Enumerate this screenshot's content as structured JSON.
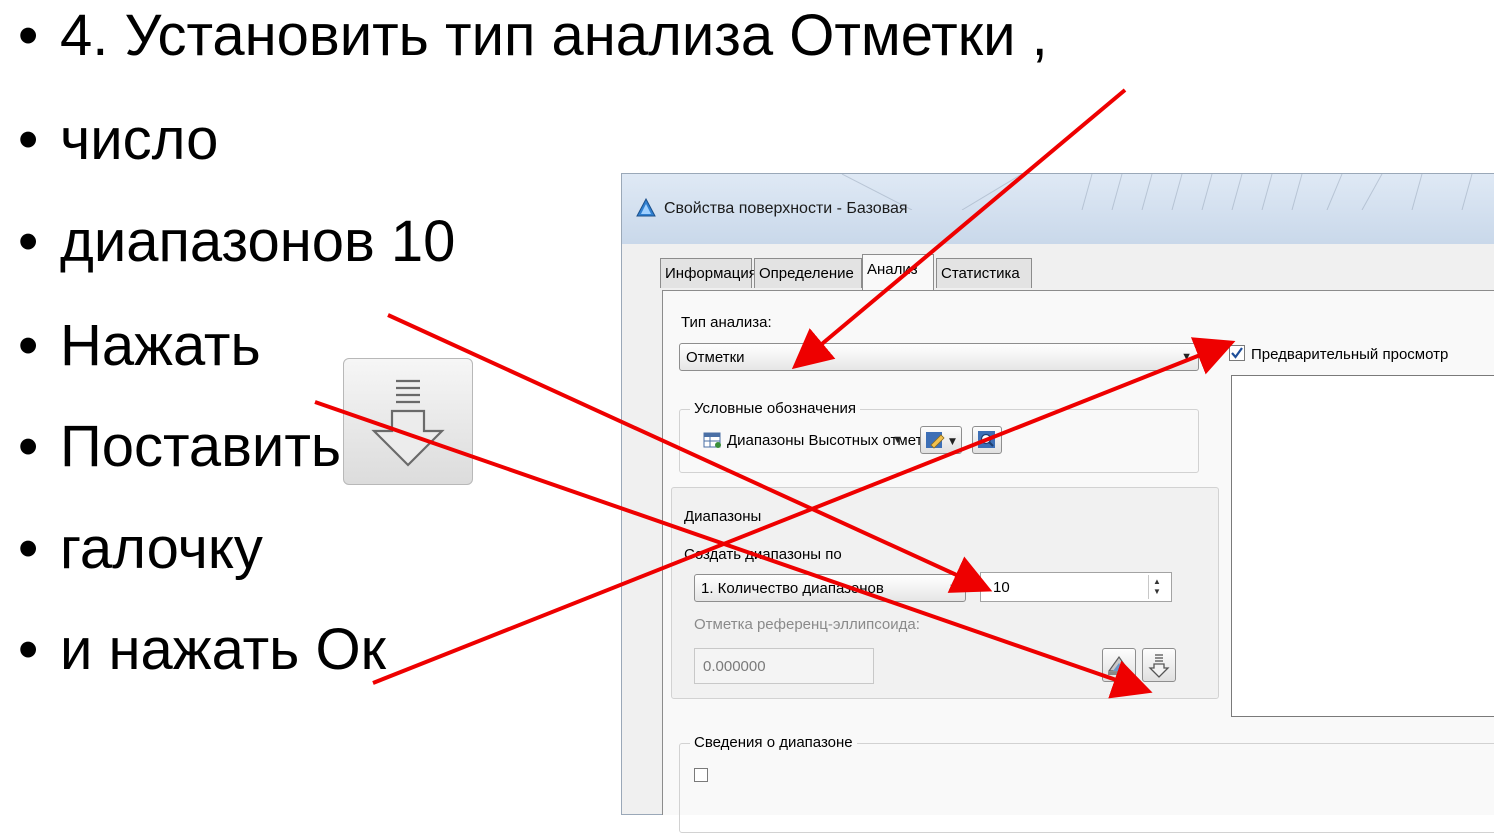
{
  "slide": {
    "bullets": [
      "4. Установить тип анализа Отметки ,",
      "число",
      "диапазонов 10",
      "Нажать",
      "Поставить",
      "галочку",
      "и нажать Ок"
    ],
    "bullet_glyph": "•",
    "big_icon": "generate-ranges-icon"
  },
  "dialog": {
    "title": "Свойства поверхности - Базовая",
    "app_icon": "autocad-civil-triangle-icon",
    "tabs": [
      "Информация",
      "Определение",
      "Анализ",
      "Статистика"
    ],
    "active_tab": "Анализ",
    "analysis_type_label": "Тип анализа:",
    "analysis_type_value": "Отметки",
    "legend_group_label": "Условные обозначения",
    "legend_value": "Диапазоны Высотных отметок",
    "ranges_group_label": "Диапазоны",
    "create_ranges_label": "Создать диапазоны по",
    "create_ranges_value": "1. Количество диапазонов",
    "ranges_count": "10",
    "reference_label": "Отметка референц-эллипсоида:",
    "reference_value": "0.000000",
    "preview_label": "Предварительный просмотр",
    "preview_checked": true,
    "range_details_label": "Сведения о диапазоне"
  },
  "colors": {
    "annotation_arrow": "#ee0000",
    "titlebar": "#d4e1f0",
    "panel": "#f9f9f9"
  }
}
